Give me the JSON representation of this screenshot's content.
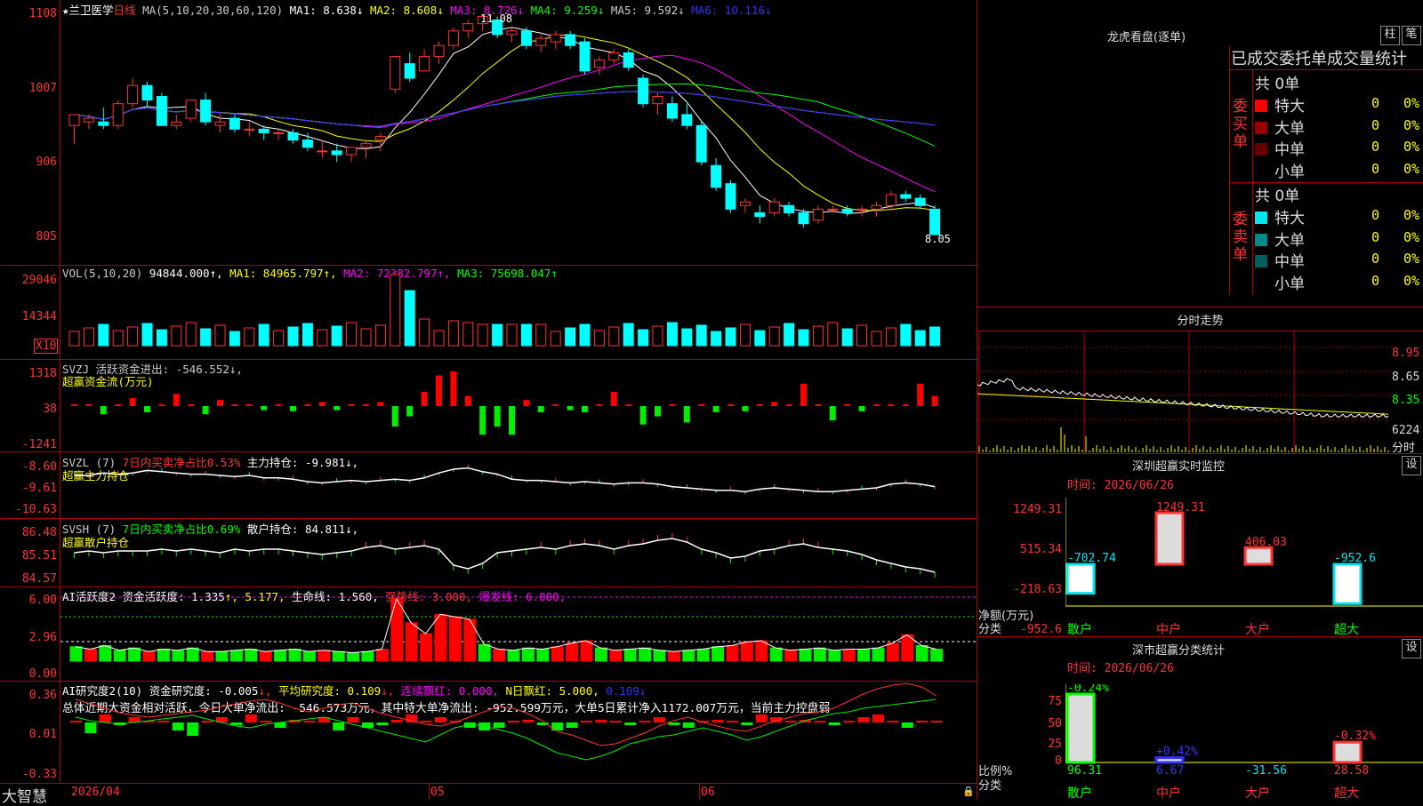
{
  "header": {
    "stock": "★兰卫医学",
    "period": "日线",
    "ma_label": "MA(5,10,20,30,60,120)",
    "ma": [
      {
        "name": "MA1:",
        "value": "8.638↓",
        "color": "#ffffff"
      },
      {
        "name": "MA2:",
        "value": "8.608↓",
        "color": "#ffff00"
      },
      {
        "name": "MA3:",
        "value": "8.726↓",
        "color": "#ff00ff"
      },
      {
        "name": "MA4:",
        "value": "9.259↓",
        "color": "#00ff00"
      },
      {
        "name": "MA5:",
        "value": "9.592↓",
        "color": "#cccccc"
      },
      {
        "name": "MA6:",
        "value": "10.116↓",
        "color": "#3333ff"
      }
    ]
  },
  "price_axis": [
    "1108",
    "1007",
    "906",
    "805"
  ],
  "price_annotations": {
    "high": "11.08",
    "low": "8.05"
  },
  "volume": {
    "label": "VOL(5,10,20)",
    "value": "94844.000↑,",
    "ma1": "MA1: 84965.797↑,",
    "ma2": "MA2: 72382.797↑,",
    "ma3": "MA3: 75698.047↑",
    "axis": [
      "29046",
      "14344"
    ],
    "unit": "X10"
  },
  "svzj": {
    "label": "SVZJ  活跃资金进出: -546.552↓,",
    "sub": "超赢资金流(万元)",
    "axis": [
      "1318",
      "38",
      "-1241"
    ]
  },
  "svzl": {
    "label": "SVZL (7) ",
    "label2": "7日内买卖净占比0.53%",
    "label3": " 主力持仓: -9.981↓,",
    "sub": "超赢主力持仓",
    "axis": [
      "-8.60",
      "-9.61",
      "-10.63"
    ]
  },
  "svsh": {
    "label": "SVSH (7) ",
    "label2": "7日内买卖净占比0.69%",
    "label3": " 散户持仓: 84.811↓,",
    "sub": "超赢散户持仓",
    "axis": [
      "86.48",
      "85.51",
      "84.57"
    ]
  },
  "ai1": {
    "label": "AI活跃度2 资金活跃度: 1.335",
    "l2": "↑, 5.177,",
    "l3": " 生命线: 1.560,",
    "l4": " 强势线: 3.000,",
    "l5": " 爆发线: 6.000,",
    "axis": [
      "6.00",
      "2.96",
      "0.00"
    ]
  },
  "ai2": {
    "label": "AI研究度2(10) 资金研究度: -0.005",
    "l2": "↓,",
    "l3": " 平均研究度: 0.109",
    "l4": "↓,",
    "l5": " 连续飘红: 0.000,",
    "l6": " N日飘红: 5.000,",
    "l7": " 0.109↓",
    "desc": "总体近期大资金相对活跃，今日大单净流出: -546.573万元，其中特大单净流出: -952.599万元，大单5日累计净入1172.007万元，当前主力控盘弱",
    "axis": [
      "0.36",
      "0.01",
      "-0.33"
    ]
  },
  "footer": {
    "brand": "大智慧",
    "dates": [
      "2026/04",
      "05",
      "06"
    ]
  },
  "panel_lhb": {
    "title": "龙虎看盘(逐单)",
    "btn1": "柱",
    "btn2": "笔",
    "tabs": "已成交委托单成交量统计",
    "buy_label": "委买单",
    "sell_label": "委卖单",
    "buy_total": "共 0单",
    "sell_total": "共 0单",
    "buy_rows": [
      {
        "name": "特大",
        "count": "0",
        "pct": "0%",
        "color": "#ff0000"
      },
      {
        "name": "大单",
        "count": "0",
        "pct": "0%",
        "color": "#990000"
      },
      {
        "name": "中单",
        "count": "0",
        "pct": "0%",
        "color": "#660000"
      },
      {
        "name": "小单",
        "count": "0",
        "pct": "0%",
        "color": ""
      }
    ],
    "sell_rows": [
      {
        "name": "特大",
        "count": "0",
        "pct": "0%",
        "color": "#00e5ee"
      },
      {
        "name": "大单",
        "count": "0",
        "pct": "0%",
        "color": "#008b8b"
      },
      {
        "name": "中单",
        "count": "0",
        "pct": "0%",
        "color": "#006060"
      },
      {
        "name": "小单",
        "count": "0",
        "pct": "0%",
        "color": ""
      }
    ]
  },
  "panel_fs": {
    "title": "分时走势",
    "axis": [
      "8.95",
      "8.65",
      "8.35"
    ],
    "vol_axis": "6224",
    "unit": "分时"
  },
  "panel_sz": {
    "title": "深圳超赢实时监控",
    "btn": "设",
    "time": "时间: 2026/06/26",
    "axis": [
      "1249.31",
      "515.34",
      "-218.63",
      "-952.6"
    ],
    "ylabel": "净额(万元)",
    "xlabel": "分类",
    "bars": [
      {
        "name": "散户",
        "value": -702.74,
        "label": "-702.74"
      },
      {
        "name": "中户",
        "value": 1249.31,
        "label": "1249.31"
      },
      {
        "name": "大户",
        "value": 406.03,
        "label": "406.03"
      },
      {
        "name": "超大",
        "value": -952.6,
        "label": "-952.6"
      }
    ]
  },
  "panel_sc": {
    "title": "深市超赢分类统计",
    "btn": "设",
    "time": "时间: 2026/06/26",
    "axis": [
      "75",
      "50",
      "25",
      "0"
    ],
    "ylabel": "比例%",
    "xlabel": "分类",
    "bars": [
      {
        "name": "散户",
        "value": 96.31,
        "top": "-0.24%",
        "bottom": "96.31"
      },
      {
        "name": "中户",
        "value": 6.67,
        "top": "+0.42%",
        "bottom": "6.67"
      },
      {
        "name": "大户",
        "value": -31.56,
        "top": "",
        "bottom": "-31.56"
      },
      {
        "name": "超大",
        "value": 28.58,
        "top": "-0.32%",
        "bottom": "28.58"
      }
    ]
  },
  "chart_data": {
    "type": "candlestick",
    "title": "兰卫医学 日线",
    "ylim": [
      8.0,
      11.1
    ],
    "candles": [
      [
        9.55,
        9.7,
        9.3,
        9.7
      ],
      [
        9.6,
        9.7,
        9.5,
        9.65
      ],
      [
        9.6,
        9.8,
        9.5,
        9.55
      ],
      [
        9.55,
        9.9,
        9.5,
        9.85
      ],
      [
        9.85,
        10.2,
        9.8,
        10.1
      ],
      [
        10.1,
        10.15,
        9.8,
        9.9
      ],
      [
        9.95,
        10.0,
        9.55,
        9.55
      ],
      [
        9.55,
        9.7,
        9.5,
        9.6
      ],
      [
        9.65,
        9.9,
        9.6,
        9.9
      ],
      [
        9.9,
        10.0,
        9.55,
        9.6
      ],
      [
        9.55,
        9.7,
        9.45,
        9.6
      ],
      [
        9.65,
        9.7,
        9.45,
        9.5
      ],
      [
        9.5,
        9.6,
        9.4,
        9.5
      ],
      [
        9.5,
        9.55,
        9.35,
        9.45
      ],
      [
        9.45,
        9.5,
        9.35,
        9.45
      ],
      [
        9.45,
        9.5,
        9.3,
        9.35
      ],
      [
        9.35,
        9.45,
        9.2,
        9.25
      ],
      [
        9.2,
        9.35,
        9.1,
        9.2
      ],
      [
        9.2,
        9.3,
        9.05,
        9.15
      ],
      [
        9.15,
        9.25,
        9.05,
        9.25
      ],
      [
        9.25,
        9.35,
        9.1,
        9.3
      ],
      [
        9.35,
        9.45,
        9.2,
        9.4
      ],
      [
        10.05,
        10.5,
        10.0,
        10.5
      ],
      [
        10.4,
        10.55,
        10.15,
        10.2
      ],
      [
        10.3,
        10.6,
        10.3,
        10.5
      ],
      [
        10.5,
        10.7,
        10.4,
        10.65
      ],
      [
        10.65,
        10.9,
        10.6,
        10.85
      ],
      [
        10.85,
        11.0,
        10.75,
        10.95
      ],
      [
        10.95,
        11.08,
        10.85,
        11.05
      ],
      [
        11.0,
        11.05,
        10.75,
        10.8
      ],
      [
        10.8,
        10.9,
        10.7,
        10.85
      ],
      [
        10.85,
        10.9,
        10.6,
        10.65
      ],
      [
        10.65,
        10.8,
        10.55,
        10.75
      ],
      [
        10.7,
        10.85,
        10.6,
        10.8
      ],
      [
        10.8,
        10.85,
        10.6,
        10.65
      ],
      [
        10.7,
        10.75,
        10.25,
        10.3
      ],
      [
        10.35,
        10.5,
        10.25,
        10.45
      ],
      [
        10.45,
        10.6,
        10.4,
        10.55
      ],
      [
        10.55,
        10.6,
        10.3,
        10.35
      ],
      [
        10.2,
        10.25,
        9.8,
        9.85
      ],
      [
        9.85,
        10.0,
        9.7,
        9.95
      ],
      [
        9.85,
        9.95,
        9.6,
        9.65
      ],
      [
        9.7,
        9.85,
        9.5,
        9.55
      ],
      [
        9.55,
        9.6,
        9.0,
        9.05
      ],
      [
        9.0,
        9.1,
        8.65,
        8.7
      ],
      [
        8.75,
        8.8,
        8.35,
        8.4
      ],
      [
        8.45,
        8.55,
        8.35,
        8.5
      ],
      [
        8.35,
        8.45,
        8.2,
        8.3
      ],
      [
        8.35,
        8.55,
        8.3,
        8.5
      ],
      [
        8.45,
        8.5,
        8.3,
        8.35
      ],
      [
        8.35,
        8.4,
        8.15,
        8.2
      ],
      [
        8.25,
        8.45,
        8.2,
        8.4
      ],
      [
        8.4,
        8.45,
        8.35,
        8.4
      ],
      [
        8.4,
        8.45,
        8.3,
        8.35
      ],
      [
        8.4,
        8.45,
        8.3,
        8.4
      ],
      [
        8.4,
        8.5,
        8.3,
        8.45
      ],
      [
        8.45,
        8.65,
        8.4,
        8.6
      ],
      [
        8.6,
        8.65,
        8.5,
        8.55
      ],
      [
        8.55,
        8.6,
        8.4,
        8.45
      ],
      [
        8.4,
        8.45,
        8.05,
        8.05
      ]
    ]
  }
}
